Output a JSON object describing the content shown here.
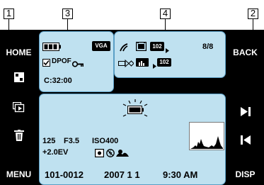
{
  "callouts": [
    "1",
    "3",
    "4",
    "2"
  ],
  "left_sidebar": {
    "home_label": "HOME",
    "menu_label": "MENU"
  },
  "right_sidebar": {
    "back_label": "BACK",
    "disp_label": "DISP"
  },
  "top_left_panel": {
    "image_size": "VGA",
    "dpof_label": "DPOF",
    "counter": "C:32:00"
  },
  "top_right_panel": {
    "folder_number": "102",
    "folder_number_2": "102",
    "image_count": "8/8"
  },
  "bottom_panel": {
    "shutter_speed": "125",
    "aperture": "F3.5",
    "iso": "ISO400",
    "exposure_comp": "+2.0EV",
    "file_number": "101-0012",
    "date": "2007  1  1",
    "time": "9:30 AM"
  },
  "colors": {
    "panel_bg": "#bfe1f0",
    "panel_border": "#5a9fc6",
    "sidebar_bg": "#000000"
  }
}
